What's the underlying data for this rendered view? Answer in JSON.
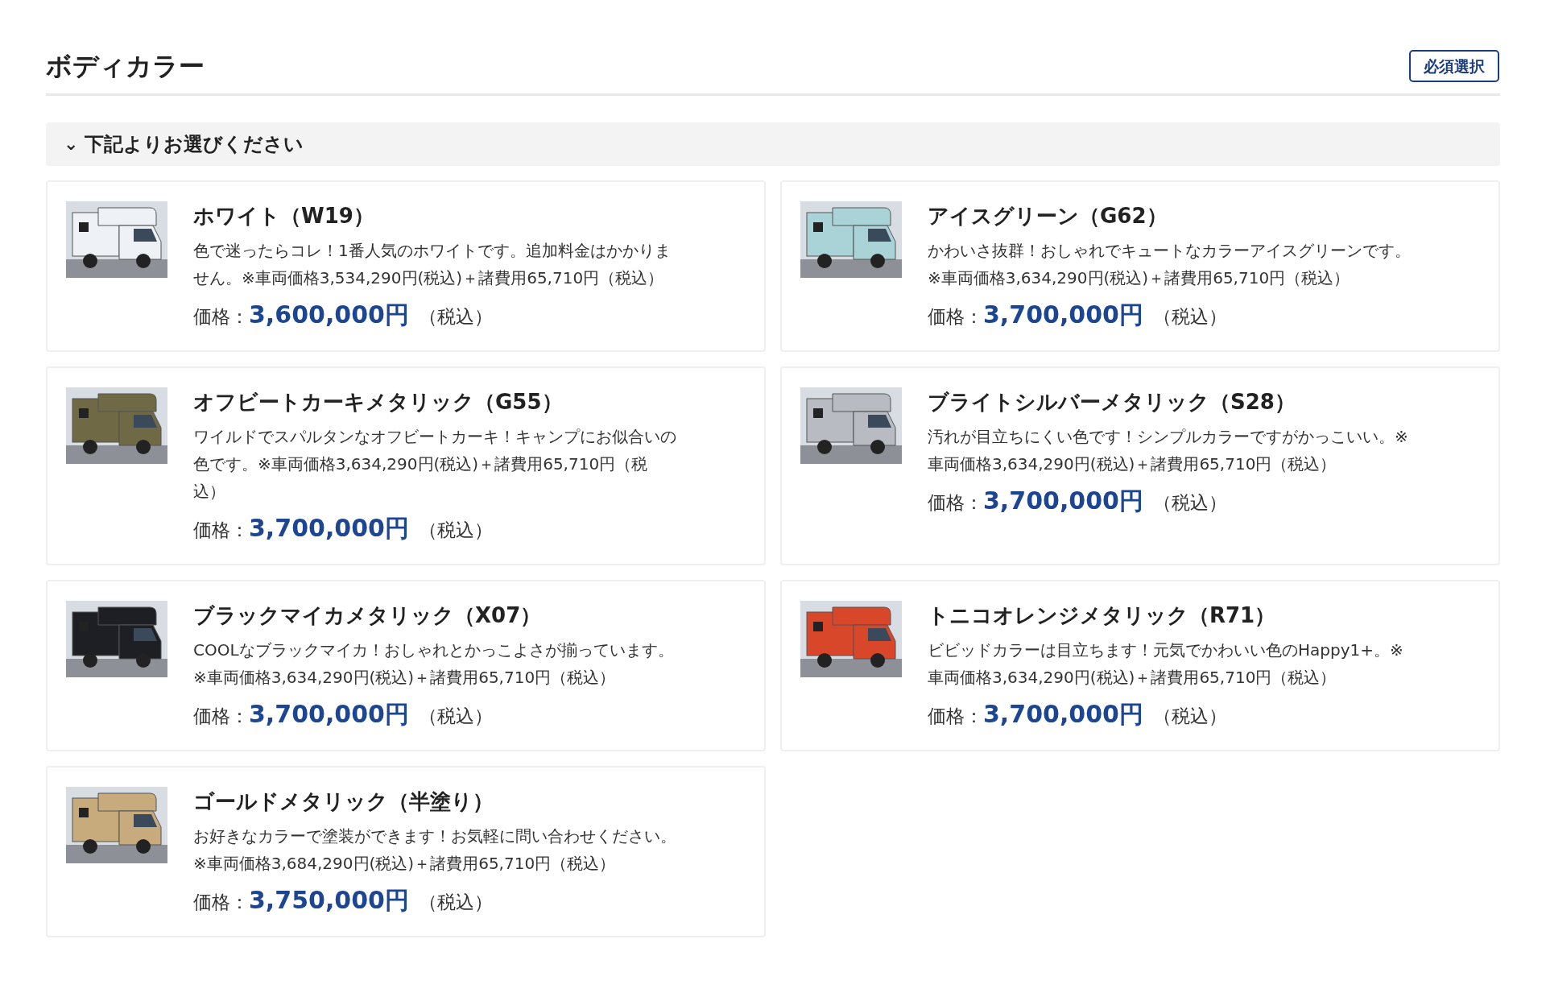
{
  "section": {
    "title": "ボディカラー",
    "badge": "必須選択"
  },
  "accordion": {
    "icon": "⌄",
    "label": "下記よりお選びください",
    "expanded": true
  },
  "options": [
    {
      "name": "ホワイト（W19）",
      "color": "#eef2f6",
      "description_lines": [
        "色で迷ったらコレ！1番人気のホワイトです。追加料金はかかりま",
        "せん。※車両価格3,534,290円(税込)＋諸費用65,710円（税込）"
      ],
      "price_label": "価格：",
      "price": "3,600,000円",
      "tax": "（税込）"
    },
    {
      "name": "アイスグリーン（G62）",
      "color": "#a9d3d6",
      "description_lines": [
        "かわいさ抜群！おしゃれでキュートなカラーアイスグリーンです。",
        "※車両価格3,634,290円(税込)＋諸費用65,710円（税込）"
      ],
      "price_label": "価格：",
      "price": "3,700,000円",
      "tax": "（税込）"
    },
    {
      "name": "オフビートカーキメタリック（G55）",
      "color": "#6f6a45",
      "description_lines": [
        "ワイルドでスパルタンなオフビートカーキ！キャンプにお似合いの",
        "色です。※車両価格3,634,290円(税込)＋諸費用65,710円（税",
        "込）"
      ],
      "price_label": "価格：",
      "price": "3,700,000円",
      "tax": "（税込）"
    },
    {
      "name": "ブライトシルバーメタリック（S28）",
      "color": "#b8bcc2",
      "description_lines": [
        "汚れが目立ちにくい色です！シンプルカラーですがかっこいい。※",
        "車両価格3,634,290円(税込)＋諸費用65,710円（税込）"
      ],
      "price_label": "価格：",
      "price": "3,700,000円",
      "tax": "（税込）"
    },
    {
      "name": "ブラックマイカメタリック（X07）",
      "color": "#1e1f24",
      "description_lines": [
        "COOLなブラックマイカ！おしゃれとかっこよさが揃っています。",
        "※車両価格3,634,290円(税込)＋諸費用65,710円（税込）"
      ],
      "price_label": "価格：",
      "price": "3,700,000円",
      "tax": "（税込）"
    },
    {
      "name": "トニコオレンジメタリック（R71）",
      "color": "#d9472b",
      "description_lines": [
        "ビビッドカラーは目立ちます！元気でかわいい色のHappy1+。※",
        "車両価格3,634,290円(税込)＋諸費用65,710円（税込）"
      ],
      "price_label": "価格：",
      "price": "3,700,000円",
      "tax": "（税込）"
    },
    {
      "name": "ゴールドメタリック（半塗り）",
      "color": "#c8ab7c",
      "description_lines": [
        "お好きなカラーで塗装ができます！お気軽に問い合わせください。",
        "※車両価格3,684,290円(税込)＋諸費用65,710円（税込）"
      ],
      "price_label": "価格：",
      "price": "3,750,000円",
      "tax": "（税込）"
    }
  ]
}
